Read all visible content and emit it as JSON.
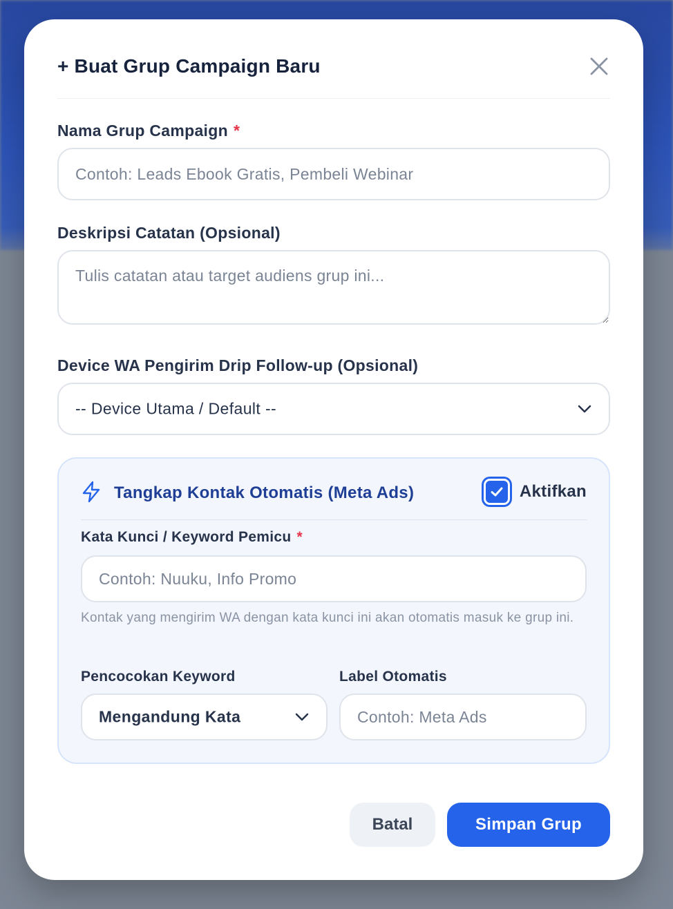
{
  "modal": {
    "title": "+ Buat Grup Campaign Baru",
    "close_icon": "close-icon"
  },
  "fields": {
    "group_name": {
      "label": "Nama Grup Campaign",
      "required_mark": "*",
      "placeholder": "Contoh: Leads Ebook Gratis, Pembeli Webinar",
      "value": ""
    },
    "description": {
      "label": "Deskripsi Catatan (Opsional)",
      "placeholder": "Tulis catatan atau target audiens grup ini...",
      "value": ""
    },
    "device": {
      "label": "Device WA Pengirim Drip Follow-up (Opsional)",
      "selected": "-- Device Utama / Default --",
      "icon": "chevron-down-icon"
    }
  },
  "auto_capture": {
    "icon": "lightning-icon",
    "title": "Tangkap Kontak Otomatis (Meta Ads)",
    "toggle_label": "Aktifkan",
    "enabled": true,
    "keyword": {
      "label": "Kata Kunci / Keyword Pemicu",
      "required_mark": "*",
      "placeholder": "Contoh: Nuuku, Info Promo",
      "value": ""
    },
    "hint": "Kontak yang mengirim WA dengan kata kunci ini akan otomatis masuk ke grup ini.",
    "match": {
      "label": "Pencocokan Keyword",
      "selected": "Mengandung Kata",
      "icon": "chevron-down-icon"
    },
    "auto_label": {
      "label": "Label Otomatis",
      "placeholder": "Contoh: Meta Ads",
      "value": ""
    }
  },
  "actions": {
    "cancel_label": "Batal",
    "save_label": "Simpan Grup"
  },
  "colors": {
    "primary": "#2563eb",
    "title_text": "#17233c",
    "required": "#e5344a",
    "panel_bg": "#f3f6fc",
    "panel_title": "#1f3f96"
  }
}
